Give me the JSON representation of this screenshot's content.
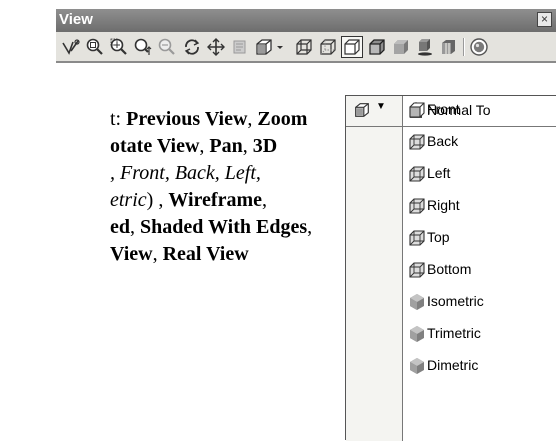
{
  "window": {
    "title": "View",
    "close_glyph": "×"
  },
  "toolbar": {
    "tools": [
      {
        "icon": "previous-view-icon"
      },
      {
        "icon": "zoom-to-fit-icon"
      },
      {
        "icon": "zoom-to-area-icon"
      },
      {
        "icon": "zoom-in-out-icon"
      },
      {
        "icon": "zoom-to-selection-icon"
      },
      {
        "icon": "rotate-view-icon"
      },
      {
        "icon": "pan-icon"
      },
      {
        "icon": "roll-view-icon"
      },
      {
        "icon": "standard-views-icon"
      },
      {
        "icon": "wireframe-icon"
      },
      {
        "icon": "hidden-lines-visible-icon"
      },
      {
        "icon": "hidden-lines-removed-icon"
      },
      {
        "icon": "shaded-with-edges-icon"
      },
      {
        "icon": "shaded-icon"
      },
      {
        "icon": "shadows-in-shaded-mode-icon"
      },
      {
        "icon": "section-view-icon"
      },
      {
        "icon": "realview-graphics-icon"
      }
    ]
  },
  "body": {
    "line1_prefix": "t: ",
    "line1_bold": "Previous View",
    "line1_sep": ", ",
    "line1_bold2": "Zoom",
    "line2_bold": "otate View",
    "line2_sep": ", ",
    "line2_bold2": "Pan",
    "line2_sep2": ", ",
    "line2_bold3": "3D",
    "line3_italic": ", Front, Back, Left,",
    "line4_italic": "etric",
    "line4_rest": ") , ",
    "line4_bold": "Wireframe",
    "line4_end": ",",
    "line5_bold": "ed",
    "line5_sep": ", ",
    "line5_bold2": "Shaded With Edges",
    "line5_end": ",",
    "line6_bold": "View",
    "line6_sep": ", ",
    "line6_bold2": "Real View"
  },
  "dropdown": {
    "header_icon": "standard-views-icon",
    "arrow": "▼",
    "normal_to": "Normal To",
    "items": [
      {
        "label": "Front",
        "icon": "front-view-icon"
      },
      {
        "label": "Back",
        "icon": "back-view-icon"
      },
      {
        "label": "Left",
        "icon": "left-view-icon"
      },
      {
        "label": "Right",
        "icon": "right-view-icon"
      },
      {
        "label": "Top",
        "icon": "top-view-icon"
      },
      {
        "label": "Bottom",
        "icon": "bottom-view-icon"
      },
      {
        "label": "Isometric",
        "icon": "isometric-view-icon"
      },
      {
        "label": "Trimetric",
        "icon": "trimetric-view-icon"
      },
      {
        "label": "Dimetric",
        "icon": "dimetric-view-icon"
      }
    ]
  },
  "colors": {
    "titlebar": "#7c7c7c",
    "toolbar_bg": "#e4e3de",
    "icon_dark": "#333333",
    "icon_gray": "#9a9a9a",
    "shaded_gray": "#8e8e8e"
  }
}
